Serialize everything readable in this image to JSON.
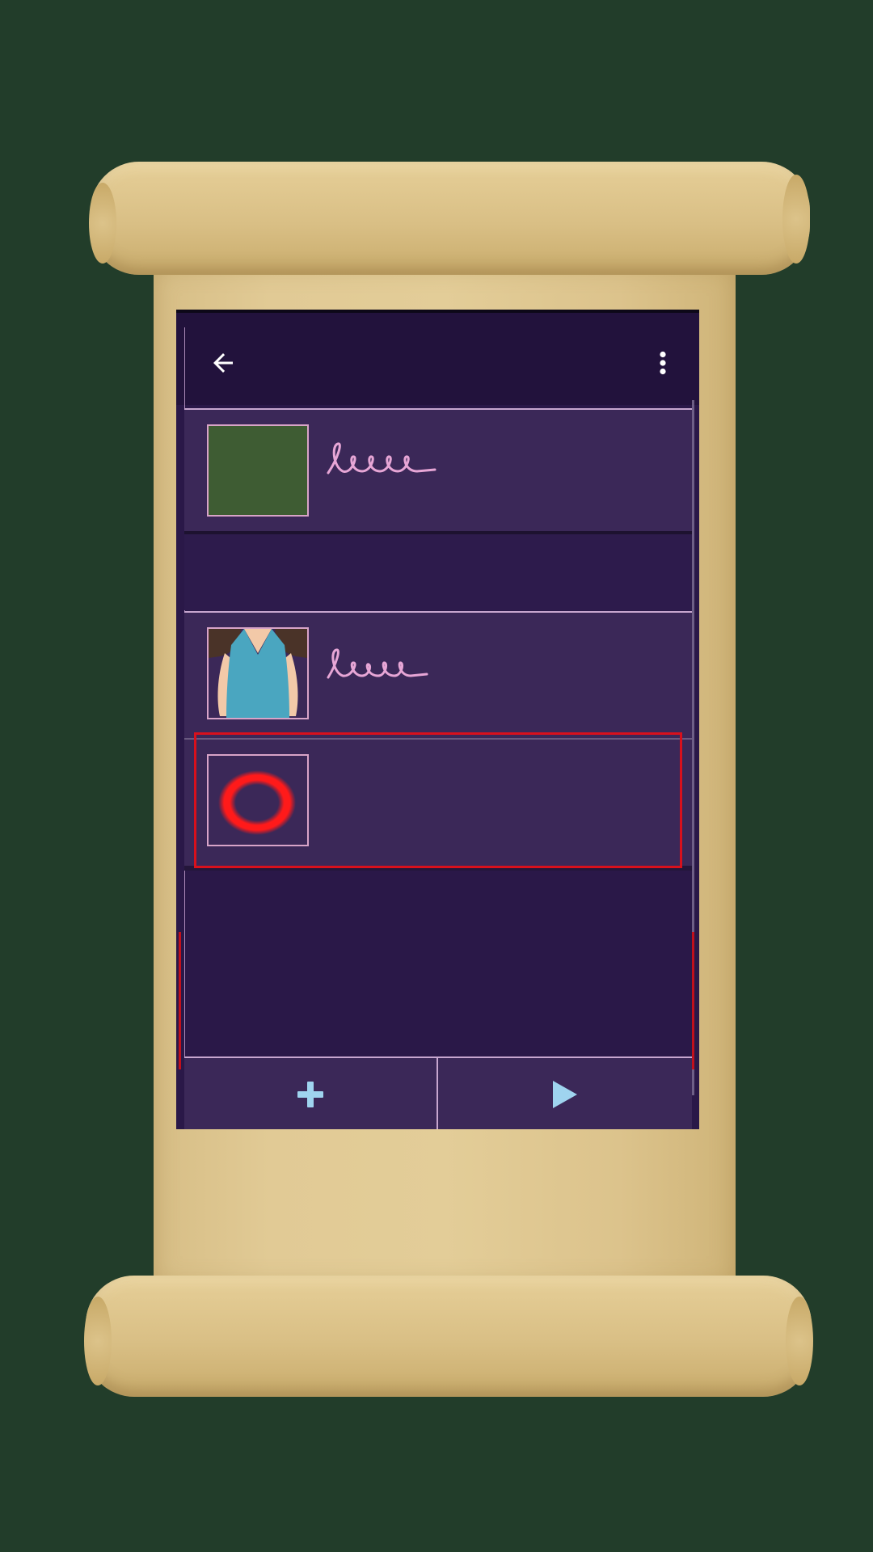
{
  "app": {
    "background_color": "#223d2a",
    "accent_color": "#9fd4ef",
    "selection_color": "#d8101c"
  },
  "appbar": {
    "back_icon": "arrow-left-icon",
    "menu_icon": "more-vertical-icon"
  },
  "list": {
    "items": [
      {
        "thumbnail": "green-square",
        "label_visual": "handwritten-squiggle"
      },
      {
        "thumbnail": "dress-figure",
        "label_visual": "handwritten-squiggle"
      },
      {
        "thumbnail": "red-ring",
        "label_visual": "none",
        "selected": true
      }
    ]
  },
  "bottom_bar": {
    "add_icon": "plus-icon",
    "play_icon": "play-icon"
  }
}
